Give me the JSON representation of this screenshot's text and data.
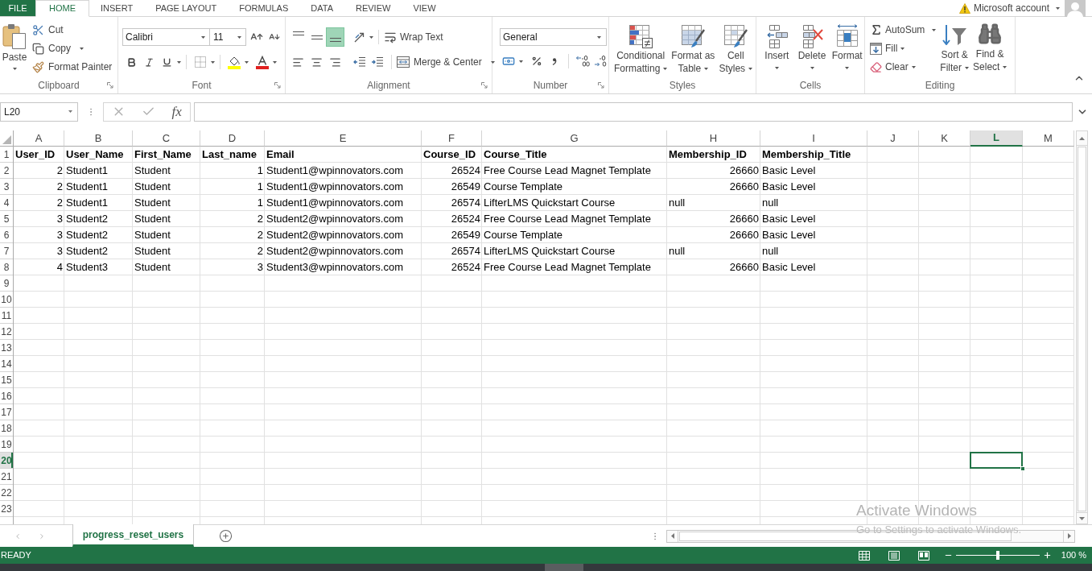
{
  "ribbon_tabs": [
    {
      "label": "FILE",
      "kind": "backstage",
      "selected": false
    },
    {
      "label": "HOME",
      "kind": "tab",
      "selected": true
    },
    {
      "label": "INSERT",
      "kind": "tab",
      "selected": false
    },
    {
      "label": "PAGE LAYOUT",
      "kind": "tab",
      "selected": false
    },
    {
      "label": "FORMULAS",
      "kind": "tab",
      "selected": false
    },
    {
      "label": "DATA",
      "kind": "tab",
      "selected": false
    },
    {
      "label": "REVIEW",
      "kind": "tab",
      "selected": false
    },
    {
      "label": "VIEW",
      "kind": "tab",
      "selected": false
    }
  ],
  "account": {
    "label": "Microsoft account",
    "warning": true
  },
  "ribbon": {
    "clipboard": {
      "title": "Clipboard",
      "paste": "Paste",
      "cut": "Cut",
      "copy": "Copy",
      "format_painter": "Format Painter"
    },
    "font": {
      "title": "Font",
      "font_name": "Calibri",
      "font_size": "11"
    },
    "alignment": {
      "title": "Alignment",
      "vertical_align": [
        {
          "kind": "top",
          "selected": false
        },
        {
          "kind": "middle",
          "selected": false
        },
        {
          "kind": "bottom",
          "selected": true
        }
      ],
      "wrap_text": "Wrap Text",
      "merge_center": "Merge & Center"
    },
    "number": {
      "title": "Number",
      "format": "General"
    },
    "styles": {
      "title": "Styles",
      "buttons": [
        {
          "kind": "conditional",
          "lines": [
            "Conditional",
            "Formatting"
          ]
        },
        {
          "kind": "table",
          "lines": [
            "Format as",
            "Table"
          ]
        },
        {
          "kind": "cell",
          "lines": [
            "Cell",
            "Styles"
          ]
        }
      ]
    },
    "cells": {
      "title": "Cells",
      "buttons": [
        {
          "kind": "insert",
          "label": "Insert"
        },
        {
          "kind": "delete",
          "label": "Delete"
        },
        {
          "kind": "format",
          "label": "Format"
        }
      ]
    },
    "editing": {
      "title": "Editing",
      "autosum": "AutoSum",
      "fill": "Fill",
      "clear": "Clear",
      "sort_filter": [
        "Sort &",
        "Filter"
      ],
      "find_select": [
        "Find &",
        "Select"
      ]
    }
  },
  "formula_bar": {
    "name_box": "L20",
    "function_button": "fx"
  },
  "sheet": {
    "columns": [
      {
        "label": "A",
        "selected": false
      },
      {
        "label": "B",
        "selected": false
      },
      {
        "label": "C",
        "selected": false
      },
      {
        "label": "D",
        "selected": false
      },
      {
        "label": "E",
        "selected": false
      },
      {
        "label": "F",
        "selected": false
      },
      {
        "label": "G",
        "selected": false
      },
      {
        "label": "H",
        "selected": false
      },
      {
        "label": "I",
        "selected": false
      },
      {
        "label": "J",
        "selected": false
      },
      {
        "label": "K",
        "selected": false
      },
      {
        "label": "L",
        "selected": true
      },
      {
        "label": "M",
        "selected": false
      }
    ],
    "rows": [
      {
        "number": "1",
        "selected": false,
        "cells": [
          {
            "value": "User_ID",
            "kind": "heading"
          },
          {
            "value": "User_Name",
            "kind": "heading"
          },
          {
            "value": "First_Name",
            "kind": "heading"
          },
          {
            "value": "Last_name",
            "kind": "heading"
          },
          {
            "value": "Email",
            "kind": "heading"
          },
          {
            "value": "Course_ID",
            "kind": "heading"
          },
          {
            "value": "Course_Title",
            "kind": "heading"
          },
          {
            "value": "Membership_ID",
            "kind": "heading"
          },
          {
            "value": "Membership_Title",
            "kind": "heading"
          }
        ]
      },
      {
        "number": "2",
        "selected": false,
        "cells": [
          {
            "value": "2",
            "kind": "number"
          },
          {
            "value": "Student1",
            "kind": "text"
          },
          {
            "value": "Student",
            "kind": "text"
          },
          {
            "value": "1",
            "kind": "number"
          },
          {
            "value": "Student1@wpinnovators.com",
            "kind": "text"
          },
          {
            "value": "26524",
            "kind": "number"
          },
          {
            "value": "Free Course Lead Magnet Template",
            "kind": "text"
          },
          {
            "value": "26660",
            "kind": "number"
          },
          {
            "value": "Basic Level",
            "kind": "text"
          }
        ]
      },
      {
        "number": "3",
        "selected": false,
        "cells": [
          {
            "value": "2",
            "kind": "number"
          },
          {
            "value": "Student1",
            "kind": "text"
          },
          {
            "value": "Student",
            "kind": "text"
          },
          {
            "value": "1",
            "kind": "number"
          },
          {
            "value": "Student1@wpinnovators.com",
            "kind": "text"
          },
          {
            "value": "26549",
            "kind": "number"
          },
          {
            "value": "Course Template",
            "kind": "text"
          },
          {
            "value": "26660",
            "kind": "number"
          },
          {
            "value": "Basic Level",
            "kind": "text"
          }
        ]
      },
      {
        "number": "4",
        "selected": false,
        "cells": [
          {
            "value": "2",
            "kind": "number"
          },
          {
            "value": "Student1",
            "kind": "text"
          },
          {
            "value": "Student",
            "kind": "text"
          },
          {
            "value": "1",
            "kind": "number"
          },
          {
            "value": "Student1@wpinnovators.com",
            "kind": "text"
          },
          {
            "value": "26574",
            "kind": "number"
          },
          {
            "value": "LifterLMS Quickstart Course",
            "kind": "text"
          },
          {
            "value": "null",
            "kind": "text"
          },
          {
            "value": "null",
            "kind": "text"
          }
        ]
      },
      {
        "number": "5",
        "selected": false,
        "cells": [
          {
            "value": "3",
            "kind": "number"
          },
          {
            "value": "Student2",
            "kind": "text"
          },
          {
            "value": "Student",
            "kind": "text"
          },
          {
            "value": "2",
            "kind": "number"
          },
          {
            "value": "Student2@wpinnovators.com",
            "kind": "text"
          },
          {
            "value": "26524",
            "kind": "number"
          },
          {
            "value": "Free Course Lead Magnet Template",
            "kind": "text"
          },
          {
            "value": "26660",
            "kind": "number"
          },
          {
            "value": "Basic Level",
            "kind": "text"
          }
        ]
      },
      {
        "number": "6",
        "selected": false,
        "cells": [
          {
            "value": "3",
            "kind": "number"
          },
          {
            "value": "Student2",
            "kind": "text"
          },
          {
            "value": "Student",
            "kind": "text"
          },
          {
            "value": "2",
            "kind": "number"
          },
          {
            "value": "Student2@wpinnovators.com",
            "kind": "text"
          },
          {
            "value": "26549",
            "kind": "number"
          },
          {
            "value": "Course Template",
            "kind": "text"
          },
          {
            "value": "26660",
            "kind": "number"
          },
          {
            "value": "Basic Level",
            "kind": "text"
          }
        ]
      },
      {
        "number": "7",
        "selected": false,
        "cells": [
          {
            "value": "3",
            "kind": "number"
          },
          {
            "value": "Student2",
            "kind": "text"
          },
          {
            "value": "Student",
            "kind": "text"
          },
          {
            "value": "2",
            "kind": "number"
          },
          {
            "value": "Student2@wpinnovators.com",
            "kind": "text"
          },
          {
            "value": "26574",
            "kind": "number"
          },
          {
            "value": "LifterLMS Quickstart Course",
            "kind": "text"
          },
          {
            "value": "null",
            "kind": "text"
          },
          {
            "value": "null",
            "kind": "text"
          }
        ]
      },
      {
        "number": "8",
        "selected": false,
        "cells": [
          {
            "value": "4",
            "kind": "number"
          },
          {
            "value": "Student3",
            "kind": "text"
          },
          {
            "value": "Student",
            "kind": "text"
          },
          {
            "value": "3",
            "kind": "number"
          },
          {
            "value": "Student3@wpinnovators.com",
            "kind": "text"
          },
          {
            "value": "26524",
            "kind": "number"
          },
          {
            "value": "Free Course Lead Magnet Template",
            "kind": "text"
          },
          {
            "value": "26660",
            "kind": "number"
          },
          {
            "value": "Basic Level",
            "kind": "text"
          }
        ]
      },
      {
        "number": "9",
        "selected": false
      },
      {
        "number": "10",
        "selected": false
      },
      {
        "number": "11",
        "selected": false
      },
      {
        "number": "12",
        "selected": false
      },
      {
        "number": "13",
        "selected": false
      },
      {
        "number": "14",
        "selected": false
      },
      {
        "number": "15",
        "selected": false
      },
      {
        "number": "16",
        "selected": false
      },
      {
        "number": "17",
        "selected": false
      },
      {
        "number": "18",
        "selected": false
      },
      {
        "number": "19",
        "selected": false
      },
      {
        "number": "20",
        "selected": true
      },
      {
        "number": "21",
        "selected": false
      },
      {
        "number": "22",
        "selected": false
      },
      {
        "number": "23",
        "selected": false
      }
    ]
  },
  "sheet_tabs": [
    {
      "label": "progress_reset_users",
      "selected": true
    }
  ],
  "status_bar": {
    "status": "READY",
    "zoom_slider": {
      "level": 0.5
    },
    "zoom": "100 %"
  },
  "activation_notice": {
    "title": "Activate Windows",
    "message": "Go to Settings to activate Windows."
  }
}
